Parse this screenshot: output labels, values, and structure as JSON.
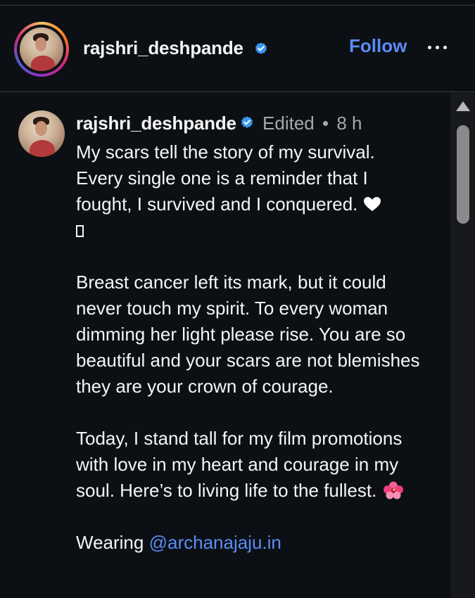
{
  "header": {
    "username": "rajshri_deshpande",
    "follow_label": "Follow",
    "more_label": "More options"
  },
  "comment": {
    "username": "rajshri_deshpande",
    "edited_label": "Edited",
    "separator": "•",
    "time": "8 h",
    "caption": {
      "p1_line1": "My scars tell the story of my survival.",
      "p1_line2": "Every single one is a reminder that I",
      "p1_line3": "fought, I survived and I conquered.",
      "p2": "Breast cancer left its mark, but it could never touch my spirit. To every woman dimming her light please rise. You are so beautiful and your scars are not blemishes they are your crown of courage.",
      "p3": "Today, I stand tall for my film promotions with love in my heart and courage in my soul. Here’s to living life to the fullest.",
      "p4_prefix": "Wearing",
      "p4_mention": "@archanajaju.in"
    }
  },
  "icons": {
    "verified": "verified-badge-icon",
    "heart": "white-heart-icon",
    "hibiscus": "hibiscus-icon",
    "more": "ellipsis-icon"
  },
  "colors": {
    "background": "#0c1014",
    "text": "#f5f5f5",
    "muted": "#a8a8a8",
    "link": "#5b8cf5",
    "verified": "#3897f0"
  }
}
